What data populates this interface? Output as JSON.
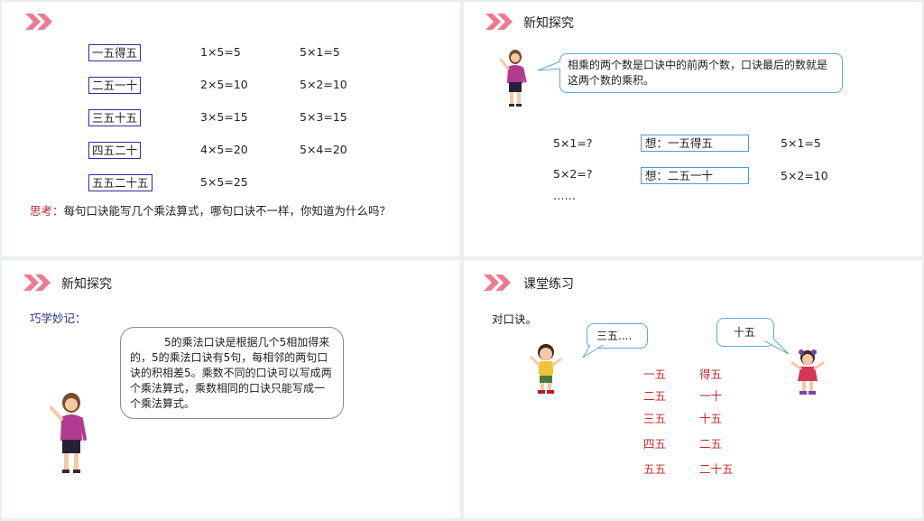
{
  "slide1": {
    "rhymes": [
      "一五得五",
      "二五一十",
      "三五十五",
      "四五二十",
      "五五二十五"
    ],
    "col_a": [
      "1×5=5",
      "2×5=10",
      "3×5=15",
      "4×5=20",
      "5×5=25"
    ],
    "col_b": [
      "5×1=5",
      "5×2=10",
      "5×3=15",
      "5×4=20"
    ],
    "think_label": "思考：",
    "think_text": "每句口诀能写几个乘法算式，哪句口诀不一样，你知道为什么吗？"
  },
  "slide2": {
    "title": "新知探究",
    "bubble": "相乘的两个数是口诀中的前两个数，口诀最后的数就是这两个数的乘积。",
    "rows": [
      {
        "q": "5×1=?",
        "think": "想：一五得五",
        "a": "5×1=5"
      },
      {
        "q": "5×2=?",
        "think": "想：二五一十",
        "a": "5×2=10"
      }
    ],
    "ellipsis": "……"
  },
  "slide3": {
    "title": "新知探究",
    "memo_label": "巧学妙记：",
    "memo_text": "5的乘法口诀是根据几个5相加得来的，5的乘法口诀有5句，每相邻的两句口诀的积相差5。乘数不同的口诀可以写成两个乘法算式，乘数相同的口诀只能写成一个乘法算式。"
  },
  "slide4": {
    "title": "课堂练习",
    "instruction": "对口诀。",
    "bubble_left": "三五....",
    "bubble_right": "十五",
    "left_words": [
      "一五",
      "二五",
      "三五",
      "四五",
      "五五"
    ],
    "right_words": [
      "得五",
      "一十",
      "十五",
      "二五",
      "二十五"
    ]
  },
  "colors": {
    "chevron": "#ef7a8e",
    "accent_red": "#c0292e",
    "box_navy": "#2d2f9a",
    "box_blue": "#4a9bd6"
  },
  "icons": [
    "double-chevron-icon",
    "teacher-figure",
    "girl-figure",
    "boy-figure"
  ]
}
